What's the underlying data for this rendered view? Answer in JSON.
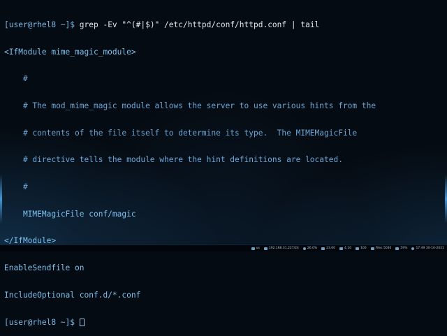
{
  "terminal": {
    "lines": [
      {
        "prompt": "[user@rhel8 ~]$ ",
        "text": "grep -Ev \"^(#|$)\" /etc/httpd/conf/httpd.conf | tail"
      },
      {
        "text": "<IfModule mime_magic_module>"
      },
      {
        "text": "    #"
      },
      {
        "text": "    # The mod_mime_magic module allows the server to use various hints from the"
      },
      {
        "text": "    # contents of the file itself to determine its type.  The MIMEMagicFile"
      },
      {
        "text": "    # directive tells the module where the hint definitions are located."
      },
      {
        "text": "    #"
      },
      {
        "text": "    MIMEMagicFile conf/magic"
      },
      {
        "text": "</IfModule>"
      },
      {
        "text": "EnableSendfile on"
      },
      {
        "text": "IncludeOptional conf.d/*.conf"
      },
      {
        "prompt": "[user@rhel8 ~]$ ",
        "text": ""
      }
    ]
  },
  "taskbar": {
    "items": [
      {
        "icon": "keyboard-icon",
        "label": "us"
      },
      {
        "icon": "network-icon",
        "label": "192.168.31.227/24"
      },
      {
        "icon": "disk-icon",
        "label": "26.0%"
      },
      {
        "icon": "memory-icon",
        "label": "23.00"
      },
      {
        "icon": "load-icon",
        "label": "4.10"
      },
      {
        "icon": "volume-icon",
        "label": "100"
      },
      {
        "icon": "files-icon",
        "label": "Files 5030"
      },
      {
        "icon": "battery-icon",
        "label": "59%"
      },
      {
        "icon": "clock-icon",
        "label": "17:49 30-10-2021"
      }
    ]
  }
}
